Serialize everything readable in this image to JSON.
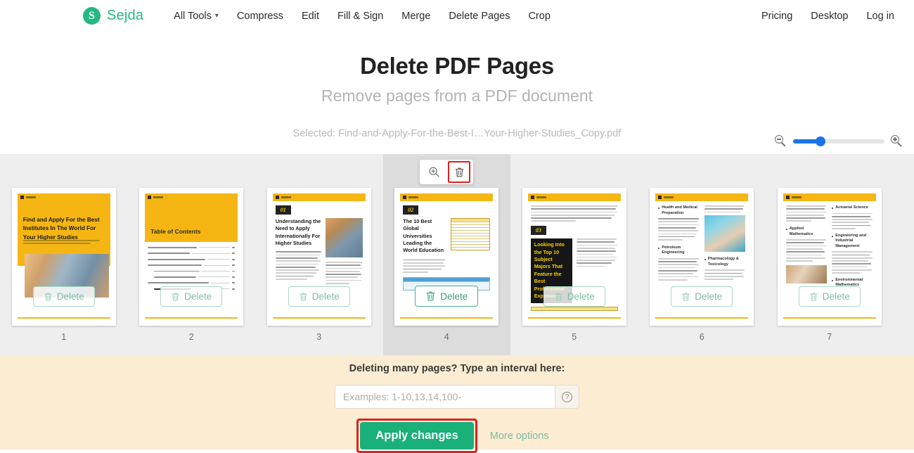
{
  "header": {
    "brand": {
      "mark": "S",
      "name": "Sejda"
    },
    "nav": [
      {
        "label": "All Tools",
        "has_caret": true
      },
      {
        "label": "Compress",
        "has_caret": false
      },
      {
        "label": "Edit",
        "has_caret": false
      },
      {
        "label": "Fill & Sign",
        "has_caret": false
      },
      {
        "label": "Merge",
        "has_caret": false
      },
      {
        "label": "Delete Pages",
        "has_caret": false
      },
      {
        "label": "Crop",
        "has_caret": false
      }
    ],
    "nav_right": [
      {
        "label": "Pricing"
      },
      {
        "label": "Desktop"
      },
      {
        "label": "Log in"
      }
    ]
  },
  "hero": {
    "title": "Delete PDF Pages",
    "subtitle": "Remove pages from a PDF document",
    "selected_file": "Selected: Find-and-Apply-For-the-Best-I…Your-Higher-Studies_Copy.pdf"
  },
  "zoom_control": {
    "zoom_out_icon": "magnifier-minus-icon",
    "zoom_in_icon": "magnifier-plus-icon",
    "value_percent": 30,
    "fill_color": "#1a73e8"
  },
  "hover_toolbar": {
    "preview_icon": "magnifier-plus-icon",
    "delete_icon": "trash-icon",
    "highlight_color": "#e02020",
    "on_page": 4
  },
  "thumbnails": {
    "delete_label": "Delete",
    "active_page": 4,
    "pages": [
      {
        "number": "1",
        "kind": "cover",
        "title": "Find and Apply For the Best Institutes In The World For Your Higher Studies",
        "subtitle": "Discover The Best Educational Institute and Tighten Your Application for Quick and Effective Results"
      },
      {
        "number": "2",
        "kind": "toc",
        "title": "Table of Contents"
      },
      {
        "number": "3",
        "kind": "section",
        "badge": "01",
        "title": "Understanding the Need to Apply Internationally For Higher Studies"
      },
      {
        "number": "4",
        "kind": "section-table",
        "badge": "02",
        "title": "The 10 Best Global Universities Leading the World Education"
      },
      {
        "number": "5",
        "kind": "section-black",
        "badge": "03",
        "title": "Looking Into the Top 10 Subject Majors That Feature the Best Professional Exposure"
      },
      {
        "number": "6",
        "kind": "bullets",
        "bullets": [
          "Health and Medical Preparation",
          "Petroleum Engineering",
          "Pharmacology & Toxicology"
        ]
      },
      {
        "number": "7",
        "kind": "bullets",
        "bullets": [
          "Actuarial Science",
          "Applied Mathematics",
          "Engineering and Industrial Management",
          "Environmental Mathematics"
        ]
      }
    ]
  },
  "bottom": {
    "interval_label": "Deleting many pages? Type an interval here:",
    "interval_placeholder": "Examples: 1-10,13,14,100-",
    "interval_value": "",
    "help_icon": "question-mark-icon",
    "apply_label": "Apply changes",
    "more_options_label": "More options",
    "apply_highlight_color": "#e02020",
    "apply_color": "#19b07a",
    "panel_color": "#fcecd2"
  }
}
